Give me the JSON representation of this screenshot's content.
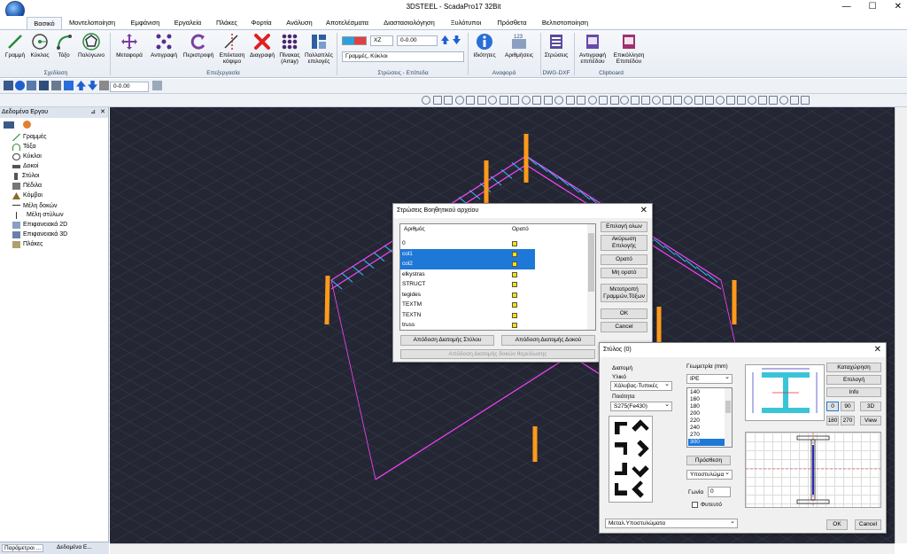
{
  "title": "3DSTEEL - ScadaPro17 32Bit",
  "window_controls": [
    "—",
    "☐",
    "✕"
  ],
  "tabs": [
    "Βασικό",
    "Μοντελοποίηση",
    "Εμφάνιση",
    "Εργαλεία",
    "Πλάκες",
    "Φορτία",
    "Ανάλυση",
    "Αποτελέσματα",
    "Διαστασιολόγηση",
    "Ξυλότυποι",
    "Πρόσθετα",
    "Βελτιστοποίηση"
  ],
  "ribbon": {
    "draw": {
      "group": "Σχεδίαση",
      "items": [
        "Γραμμή",
        "Κύκλος",
        "Τόξο",
        "Πολύγωνο"
      ]
    },
    "edit": {
      "group": "Επεξεργασία",
      "items": [
        "Μεταφορά",
        "Αντιγραφή",
        "Περιστροφή",
        "Επέκταση κόψιμο",
        "Διαγραφή",
        "Πίνακας (Array)",
        "Πολλαπλές επιλογές"
      ]
    },
    "layers": {
      "group": "Στρώσεις - Επίπεδα",
      "plane": "XZ",
      "coord": "0-0.00",
      "layer": "Γραμμές, Κύκλοι"
    },
    "ref": {
      "group": "Αναφορά",
      "items": [
        "Ιδιότητες",
        "Αριθμήσεις"
      ]
    },
    "dwg": {
      "group": "DWG-DXF",
      "items": [
        "Στρώσεις"
      ]
    },
    "clip": {
      "group": "Clipboard",
      "items": [
        "Αντιγραφή επιπέδου",
        "Επικόλληση Επιπέδου"
      ]
    }
  },
  "toolbar2": {
    "coord": "0-0.00"
  },
  "panel": {
    "title": "Δεδομένα Εργου",
    "tree": [
      "Γραμμές",
      "Τόξα",
      "Κύκλοι",
      "Δοκοί",
      "Στύλοι",
      "Πέδιλα",
      "Κόμβοι",
      "Μέλη δοκών",
      "Μέλη στύλων",
      "Επιφανειακά 2D",
      "Επιφανειακά 3D",
      "Πλάκες"
    ],
    "bottom_tabs": [
      "Παράμετροι ...",
      "Δεδομένα Ε..."
    ]
  },
  "layers_dialog": {
    "title": "Στρώσεις Βοηθητικού αρχείου",
    "col_num": "Αριθμός",
    "col_vis": "Ορατό",
    "rows": [
      {
        "name": "0",
        "sel": false
      },
      {
        "name": "col1",
        "sel": true
      },
      {
        "name": "col2",
        "sel": true
      },
      {
        "name": "elkystras",
        "sel": false
      },
      {
        "name": "STRUCT",
        "sel": false
      },
      {
        "name": "tegides",
        "sel": false
      },
      {
        "name": "TEXTM",
        "sel": false
      },
      {
        "name": "TEXTN",
        "sel": false
      },
      {
        "name": "truss",
        "sel": false
      }
    ],
    "buttons": [
      "Επιλογή ολων",
      "Ακύρωση Επιλογής",
      "Ορατό",
      "Μη ορατό",
      "Μετατροπή Γραμμών,Τόξων",
      "OK",
      "Cancel"
    ],
    "bottom_buttons": [
      "Απόδοση Διατομής Στύλου",
      "Απόδοση Διατομής Δοκού",
      "Απόδοση Διατομής δοκών θεμελίωσης"
    ]
  },
  "column_dialog": {
    "title": "Στύλος (0)",
    "section_label": "Διατομή",
    "material_label": "Υλικό",
    "material": "Χάλυβας-Τυπικές",
    "quality_label": "Ποιότητα",
    "quality": "S275(Fe430)",
    "geometry_label": "Γεωμετρία (mm)",
    "profile": "IPE",
    "sizes": [
      "140",
      "160",
      "180",
      "200",
      "220",
      "240",
      "270",
      "300"
    ],
    "selected_size": "300",
    "add_label": "Πρόσθεση",
    "support": "Υποστυλώμα",
    "angle_label": "Γωνία",
    "angle": "0",
    "phytevto": "Φυτευτό",
    "bottom_select": "Μεταλ.Υποστυλώματα",
    "buttons": [
      "Καταχώρηση",
      "Επιλογή",
      "Info",
      "0",
      "90",
      "3D",
      "180",
      "270",
      "View",
      "OK",
      "Cancel"
    ]
  }
}
